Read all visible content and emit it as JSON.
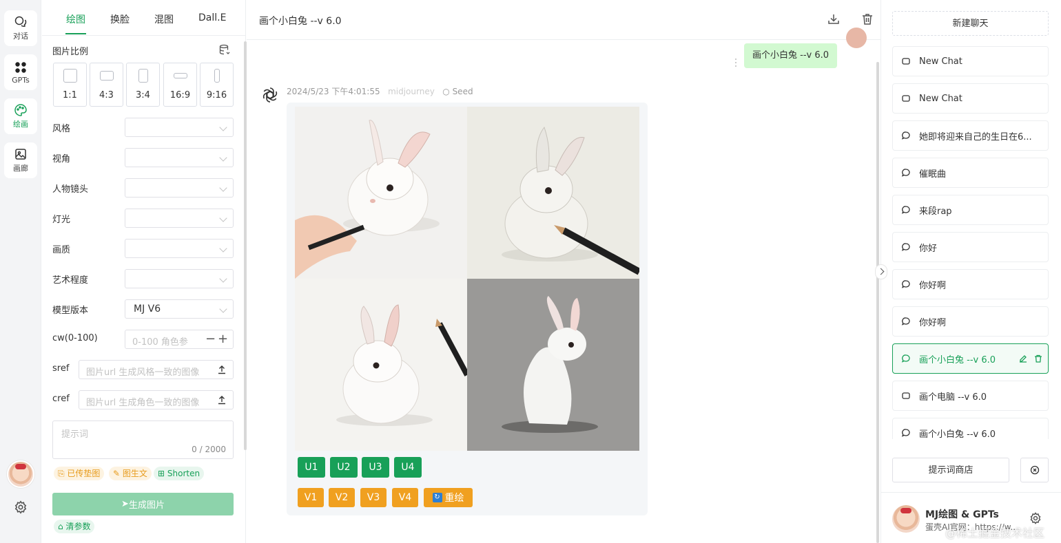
{
  "rail": {
    "items": [
      {
        "label": "对话",
        "icon": "chat-icon"
      },
      {
        "label": "GPTs",
        "icon": "apps-icon"
      },
      {
        "label": "绘画",
        "icon": "palette-icon"
      },
      {
        "label": "画廊",
        "icon": "gallery-icon"
      }
    ]
  },
  "panel": {
    "tabs": [
      "绘图",
      "换脸",
      "混图",
      "Dall.E"
    ],
    "active_tab": "绘图",
    "ratio_label": "图片比例",
    "ratios": [
      "1:1",
      "4:3",
      "3:4",
      "16:9",
      "9:16"
    ],
    "fields": {
      "style": "风格",
      "view": "视角",
      "shot": "人物镜头",
      "light": "灯光",
      "quality": "画质",
      "art": "艺术程度",
      "model": "模型版本",
      "model_value": "MJ V6",
      "cw": "cw(0-100)",
      "cw_placeholder": "0-100 角色参",
      "sref": "sref",
      "sref_placeholder": "图片url 生成风格一致的图像",
      "cref": "cref",
      "cref_placeholder": "图片url 生成角色一致的图像"
    },
    "prompt_placeholder": "提示词",
    "prompt_count": "0 / 2000",
    "tags": [
      "已传垫图",
      "图生文",
      "Shorten"
    ],
    "generate": "生成图片",
    "clear": "清参数"
  },
  "main": {
    "title": "画个小白兔 --v 6.0",
    "user_message": "画个小白兔 --v 6.0",
    "timestamp": "2024/5/23 下午4:01:55",
    "model": "midjourney",
    "seed": "Seed",
    "u_buttons": [
      "U1",
      "U2",
      "U3",
      "U4"
    ],
    "v_buttons": [
      "V1",
      "V2",
      "V3",
      "V4"
    ],
    "redo": "重绘"
  },
  "sidebar": {
    "new_chat": "新建聊天",
    "chats": [
      {
        "title": "New Chat",
        "icon": "square-icon"
      },
      {
        "title": "New Chat",
        "icon": "square-icon"
      },
      {
        "title": "她即将迎来自己的生日在6...",
        "icon": "bubble-icon"
      },
      {
        "title": "催眠曲",
        "icon": "bubble-icon"
      },
      {
        "title": "来段rap",
        "icon": "bubble-icon"
      },
      {
        "title": "你好",
        "icon": "bubble-icon"
      },
      {
        "title": "你好啊",
        "icon": "bubble-icon"
      },
      {
        "title": "你好啊",
        "icon": "bubble-icon"
      },
      {
        "title": "画个小白兔 --v 6.0",
        "icon": "bubble-icon",
        "active": true
      },
      {
        "title": "画个电脑 --v 6.0",
        "icon": "square-icon"
      },
      {
        "title": "画个小白兔 --v 6.0",
        "icon": "bubble-icon"
      }
    ],
    "prompt_store": "提示词商店",
    "footer_title": "MJ绘图 & GPTs",
    "footer_sub": "蛋壳AI官网：https://w..."
  },
  "watermark": "@稀土掘金技术社区",
  "colors": {
    "accent": "#18a058",
    "orange": "#f0a020",
    "user_bubble": "#d2f9d1"
  }
}
